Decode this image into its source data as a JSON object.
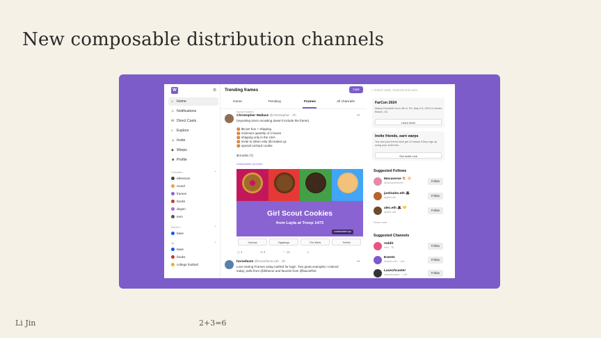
{
  "slide": {
    "title": "New composable distribution channels",
    "footer_left": "Li Jin",
    "footer_mid": "2+3=6"
  },
  "colors": {
    "background": "#f5f1e6",
    "accent": "#7c5cc9"
  },
  "app": {
    "logo": "W",
    "nav": [
      {
        "icon": "home-icon",
        "glyph": "⌂",
        "label": "Home"
      },
      {
        "icon": "bell-icon",
        "glyph": "🔔︎",
        "label": "Notifications"
      },
      {
        "icon": "mail-icon",
        "glyph": "✉",
        "label": "Direct Casts"
      },
      {
        "icon": "search-icon",
        "glyph": "⌕",
        "label": "Explore"
      },
      {
        "icon": "invite-icon",
        "glyph": "☺",
        "label": "Invite"
      },
      {
        "icon": "warps-icon",
        "glyph": "◆",
        "label": "Warps"
      },
      {
        "icon": "profile-icon",
        "glyph": "☻",
        "label": "Profile"
      }
    ],
    "favorites_label": "Favorites",
    "favorites": [
      "ethereum",
      "round",
      "frames",
      "books",
      "degen",
      "evm"
    ],
    "recent_label": "Recent",
    "recent": [
      "base"
    ],
    "all_label": "All",
    "all": [
      "base",
      "books",
      "college football"
    ],
    "center": {
      "title": "Trending frames",
      "cast_button": "Cast",
      "tabs": [
        "Home",
        "Trending",
        "Frames",
        "All channels"
      ],
      "post1": {
        "meta": "layna recasted",
        "author": "Christopher Wallace",
        "handle": "@christopher · 2h",
        "intro": "(reposting since recasting doesn't include the frame)",
        "lines": [
          "$6 per box + shipping",
          "minimum quantity of 4 boxes",
          "shipping only in the USA",
          "invite to token-only @creative gc",
          "special orchard cookie"
        ],
        "footer": "$crumbs (?)",
        "channel": "cookiecaster.xyz/order"
      },
      "frame": {
        "title": "Girl Scout Cookies",
        "subtitle": "from Layla at Troop 1473",
        "url": "cookiecaster.xyz",
        "buttons": [
          "Samoas",
          "Tagalongs",
          "Thin Mints",
          "Trefoils"
        ]
      },
      "actions": [
        "4",
        "3",
        "12",
        ""
      ],
      "post2": {
        "author": "horsefacts",
        "handle": "@horsefacts.eth · 2h",
        "line1": "Love seeing Frames using AuthKit for login. Two great examples I noticed",
        "line2": "today: polls from @ilsheroe and faucets from @faucetfirst"
      }
    },
    "right": {
      "search_placeholder": "Search casts, channels and users",
      "farcon": {
        "title": "FarCon 2024",
        "text": "Mainly Farcaster from 4th to 7th, May 2-5, 2024 in Venice Beach, CA",
        "button": "Learn More"
      },
      "invite": {
        "title": "Invite friends, earn warps",
        "text": "You and your friend each get 10 warps if they sign up using your invite link.",
        "button": "Get Invite Link"
      },
      "follows_title": "Suggested Follows",
      "follows": [
        {
          "name": "Mocaverse 🐮 🔆",
          "sub": "@mocaverseeth",
          "button": "Follow"
        },
        {
          "name": "justinahn.eth 🎩",
          "sub": "@jahn.eth",
          "button": "Follow"
        },
        {
          "name": "alec.eth 🎩 💛",
          "sub": "@alec.eth",
          "button": "Follow"
        }
      ],
      "show_more": "Show more",
      "channels_title": "Suggested Channels",
      "channels": [
        {
          "name": "reddit",
          "sub": "/red · 7K",
          "button": "Follow"
        },
        {
          "name": "Events",
          "sub": "/events-eth · 1.4K",
          "button": "Follow"
        },
        {
          "name": "Launchcaster",
          "sub": "/launchcaster · 1.4K",
          "button": "Follow"
        }
      ]
    }
  }
}
